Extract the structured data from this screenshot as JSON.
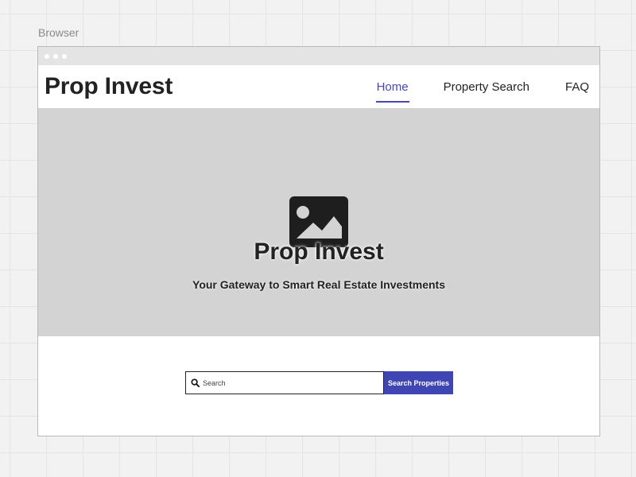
{
  "canvas": {
    "label": "Browser"
  },
  "header": {
    "logo": "Prop Invest",
    "nav": [
      {
        "label": "Home",
        "active": true
      },
      {
        "label": "Property Search",
        "active": false
      },
      {
        "label": "FAQ",
        "active": false
      }
    ]
  },
  "hero": {
    "image_icon": "image-placeholder-icon",
    "title": "Prop Invest",
    "subtitle": "Your Gateway to Smart Real Estate Investments"
  },
  "search": {
    "icon": "search-icon",
    "placeholder": "Search",
    "value": "",
    "button_label": "Search Properties"
  },
  "colors": {
    "accent": "#3f46b3",
    "hero_bg": "#d3d3d3",
    "titlebar_bg": "#e4e4e4"
  }
}
